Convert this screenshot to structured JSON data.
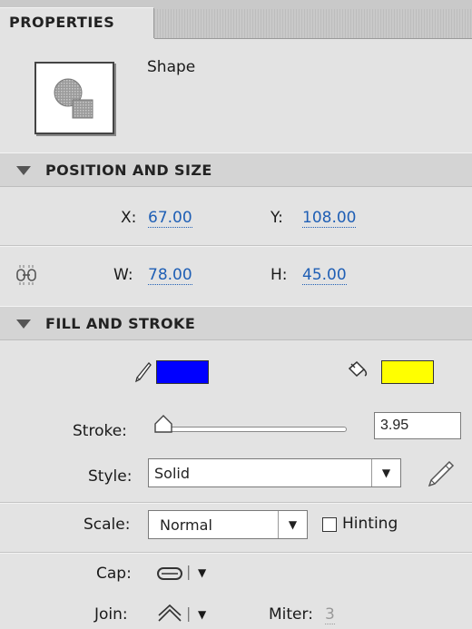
{
  "panel": {
    "tab_label": "PROPERTIES",
    "object_type": "Shape",
    "thumbnail_icon": "shape-icon"
  },
  "position_size": {
    "title": "POSITION AND SIZE",
    "x_label": "X:",
    "x_value": "67.00",
    "y_label": "Y:",
    "y_value": "108.00",
    "w_label": "W:",
    "w_value": "78.00",
    "h_label": "H:",
    "h_value": "45.00",
    "lock_icon": "link-icon"
  },
  "fill_stroke": {
    "title": "FILL AND STROKE",
    "stroke_color": "#0000ff",
    "fill_color": "#ffff00",
    "stroke_color_icon": "pencil-icon",
    "fill_color_icon": "paint-bucket-icon",
    "stroke_label": "Stroke:",
    "stroke_value": "3.95",
    "style_label": "Style:",
    "style_value": "Solid",
    "style_edit_icon": "pencil-edit-icon",
    "scale_label": "Scale:",
    "scale_value": "Normal",
    "hinting_label": "Hinting",
    "hinting_checked": false,
    "cap_label": "Cap:",
    "cap_icon": "round-cap-icon",
    "join_label": "Join:",
    "join_icon": "round-join-icon",
    "miter_label": "Miter:",
    "miter_value": "3"
  },
  "colors": {
    "link": "#1f5fb5",
    "panel_bg": "#e3e3e3",
    "header_bg": "#d4d4d4"
  }
}
